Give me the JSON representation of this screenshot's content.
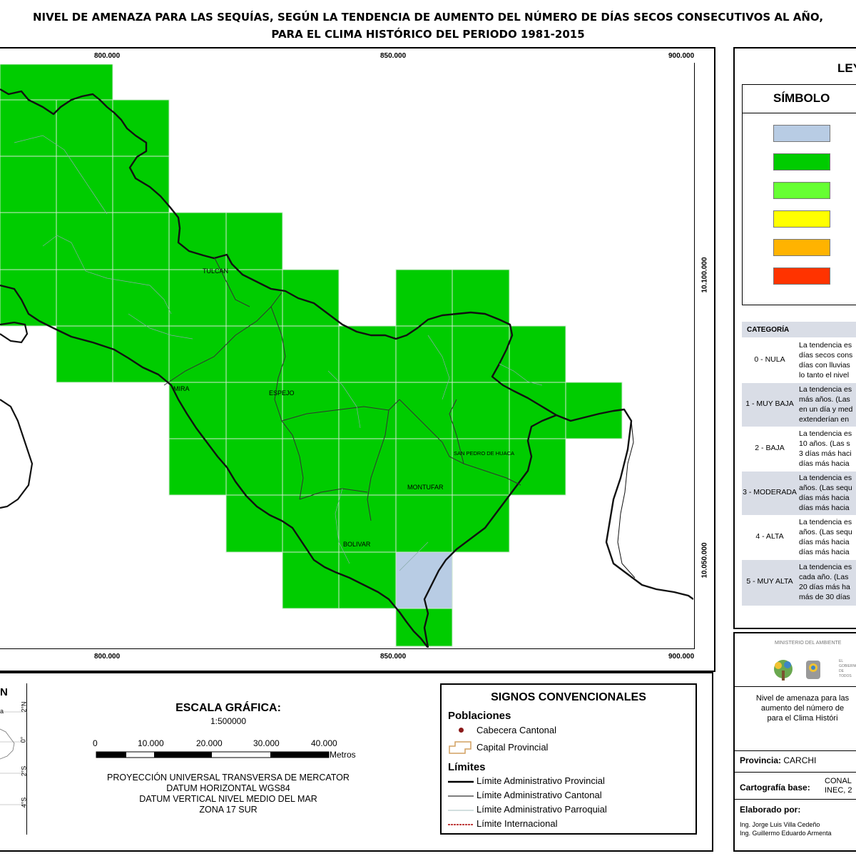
{
  "title": {
    "line1": "NIVEL DE AMENAZA PARA LAS SEQUÍAS, SEGÚN LA TENDENCIA DE AUMENTO DEL NÚMERO DE DÍAS SECOS CONSECUTIVOS AL AÑO,",
    "line2": "PARA EL CLIMA HISTÓRICO DEL PERIODO 1981-2015"
  },
  "map": {
    "x_ticks": [
      "800.000",
      "850.000",
      "900.000"
    ],
    "y_ticks": [
      "10.100.000",
      "10.050.000"
    ],
    "places": [
      "TULCAN",
      "ESPEJO",
      "MIRA",
      "SAN PEDRO DE HUACA",
      "MONTUFAR",
      "BOLIVAR"
    ],
    "colors": {
      "grid_green": "#00cc00",
      "grid_blue": "#b8cce4",
      "grid_line": "#cfe8cf"
    }
  },
  "legend": {
    "header": "LEY",
    "symbol_label": "SÍMBOLO",
    "swatches": [
      "#b8cce4",
      "#00cc00",
      "#66ff33",
      "#ffff00",
      "#ffb300",
      "#ff3300"
    ],
    "category_header": "CATEGORÍA",
    "rows": [
      {
        "cat": "0 - NULA",
        "text": [
          "La tendencia es",
          "días secos cons",
          "días con lluvias",
          "lo tanto el nivel"
        ]
      },
      {
        "cat": "1 - MUY BAJA",
        "text": [
          "La tendencia es",
          "más años. (Las",
          "en un día y med",
          "extenderían en"
        ]
      },
      {
        "cat": "2 - BAJA",
        "text": [
          "La tendencia es",
          "10 años. (Las s",
          "3 días más haci",
          "días más hacia"
        ]
      },
      {
        "cat": "3 - MODERADA",
        "text": [
          "La tendencia es",
          "años. (Las sequ",
          "días más hacia",
          "días más hacia"
        ]
      },
      {
        "cat": "4 - ALTA",
        "text": [
          "La tendencia es",
          "años. (Las sequ",
          "días más hacia",
          "días más hacia"
        ]
      },
      {
        "cat": "5 - MUY ALTA",
        "text": [
          "La tendencia es",
          "cada año. (Las",
          "20 días más ha",
          "más de 30 días"
        ]
      }
    ]
  },
  "info": {
    "ministry": "MINISTERIO DEL AMBIENTE",
    "gov_text": "EL GOBIERNO DE TODOS",
    "desc": [
      "Nivel de amenaza para las",
      "aumento del número de",
      "para el Clima Históri"
    ],
    "provincia_label": "Provincia:",
    "provincia_value": "CARCHI",
    "cartografia_label": "Cartografía base:",
    "cartografia_value": [
      "CONAL",
      "INEC, 2"
    ],
    "elaborado_label": "Elaborado por:",
    "authors": [
      "Ing. Jorge Luis Villa Cedeño",
      "Ing. Guillermo Eduardo Armenta"
    ]
  },
  "inset": {
    "title_frag": "N",
    "lat_labels": [
      "2°N",
      "0°",
      "2°S",
      "4°S"
    ],
    "frag": "a"
  },
  "scale": {
    "title": "ESCALA GRÁFICA:",
    "ratio": "1:500000",
    "ticks": [
      "0",
      "10.000",
      "20.000",
      "30.000",
      "40.000"
    ],
    "unit": "Metros",
    "projection": [
      "PROYECCIÓN UNIVERSAL TRANSVERSA DE MERCATOR",
      "DATUM HORIZONTAL WGS84",
      "DATUM VERTICAL NIVEL MEDIO DEL MAR",
      "ZONA 17 SUR"
    ]
  },
  "signs": {
    "title": "SIGNOS CONVENCIONALES",
    "poblaciones": "Poblaciones",
    "cabecera": "Cabecera Cantonal",
    "capital": "Capital Provincial",
    "limites": "Límites",
    "items": [
      "Límite Administrativo Provincial",
      "Límite Administrativo Cantonal",
      "Límite Administrativo Parroquial",
      "Límite Internacional"
    ]
  }
}
